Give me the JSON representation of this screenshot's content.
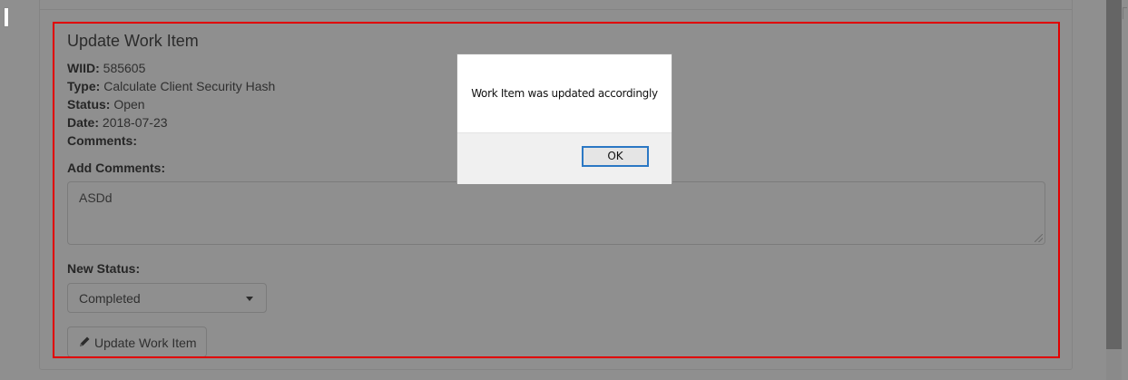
{
  "form": {
    "title": "Update Work Item",
    "wiid_label": "WIID:",
    "wiid_value": "585605",
    "type_label": "Type:",
    "type_value": "Calculate Client Security Hash",
    "status_label": "Status:",
    "status_value": "Open",
    "date_label": "Date:",
    "date_value": "2018-07-23",
    "comments_label": "Comments:",
    "add_comments_label": "Add Comments:",
    "add_comments_value": "ASDd",
    "new_status_label": "New Status:",
    "new_status_value": "Completed",
    "update_button_label": "Update Work Item",
    "update_button_icon": "pencil-icon"
  },
  "dialog": {
    "message": "Work Item was updated accordingly",
    "ok_label": "OK"
  },
  "colors": {
    "highlight_border": "#e00000",
    "ok_button_focus": "#2b78c4"
  }
}
